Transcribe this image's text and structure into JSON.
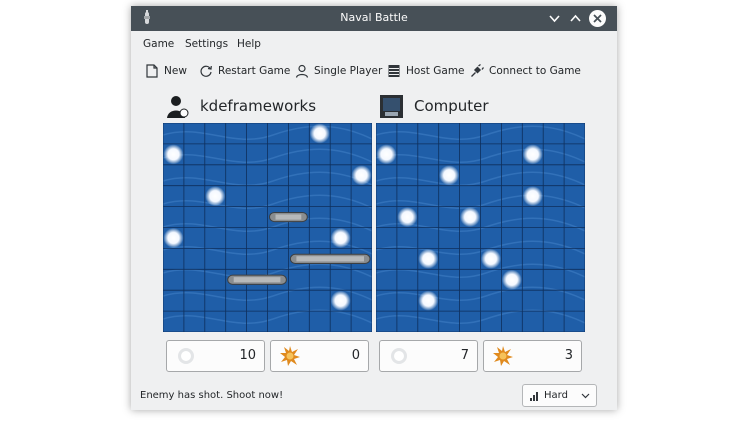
{
  "window": {
    "title": "Naval Battle"
  },
  "menu": [
    "Game",
    "Settings",
    "Help"
  ],
  "toolbar": {
    "new": "New",
    "restart": "Restart Game",
    "single": "Single Player",
    "host": "Host Game",
    "connect": "Connect to Game"
  },
  "players": {
    "left": {
      "name": "kdeframeworks",
      "misses": "10",
      "hits": "0"
    },
    "right": {
      "name": "Computer",
      "misses": "7",
      "hits": "3"
    }
  },
  "status": "Enemy has shot. Shoot now!",
  "difficulty": {
    "selected": "Hard"
  },
  "boards": {
    "size": 10,
    "left_shots": [
      [
        7,
        0
      ],
      [
        0,
        1
      ],
      [
        9,
        2
      ],
      [
        2,
        3
      ],
      [
        0,
        5
      ],
      [
        8,
        5
      ],
      [
        8,
        8
      ]
    ],
    "right_shots": [
      [
        0,
        1
      ],
      [
        7,
        1
      ],
      [
        3,
        2
      ],
      [
        7,
        3
      ],
      [
        1,
        4
      ],
      [
        4,
        4
      ],
      [
        2,
        6
      ],
      [
        5,
        6
      ],
      [
        6,
        7
      ],
      [
        2,
        8
      ]
    ],
    "left_ships": [
      {
        "row": 4,
        "col_start": 5,
        "length": 2,
        "orientation": "horizontal"
      },
      {
        "row": 6,
        "col_start": 6,
        "length": 4,
        "orientation": "horizontal"
      },
      {
        "row": 7,
        "col_start": 3,
        "length": 3,
        "orientation": "horizontal"
      }
    ]
  },
  "colors": {
    "water": "#1f5ea8",
    "titlebar": "#475057",
    "window": "#eff0f1"
  }
}
